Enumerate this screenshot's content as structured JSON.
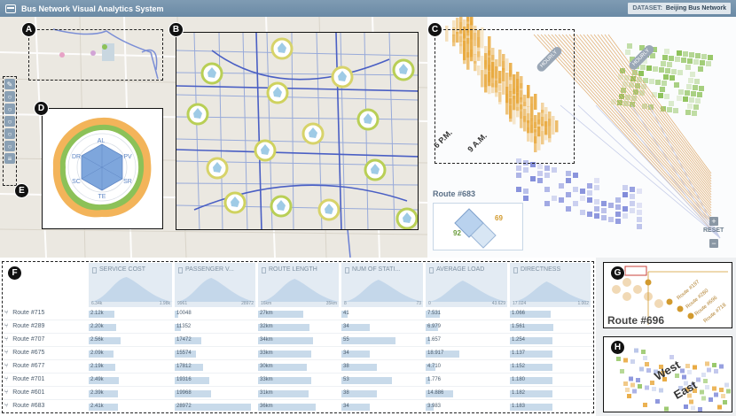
{
  "app": {
    "title": "Bus Network Visual Analytics System",
    "dataset_label": "DATASET:",
    "dataset_value": "Beijing Bus Network"
  },
  "badges": [
    "A",
    "B",
    "C",
    "D",
    "E",
    "F",
    "G",
    "H"
  ],
  "radar": {
    "axes": [
      "AL",
      "PV",
      "SR",
      "TE",
      "SC",
      "DR"
    ]
  },
  "matrix": {
    "label_6pm": "6 P.M.",
    "label_9am": "9 A.M.",
    "hourly_left": "HOURLY",
    "hourly_right": "HOURLY",
    "route_title": "Route #683",
    "compare_left": "92",
    "compare_right": "69",
    "reset": "RESET",
    "zoom_in": "+",
    "zoom_out": "−"
  },
  "table": {
    "columns": [
      {
        "name": "SERVICE COST",
        "lo": "6.34k",
        "hi": "1.98k"
      },
      {
        "name": "PASSENGER V...",
        "lo": "9961",
        "hi": "28972"
      },
      {
        "name": "ROUTE LENGTH",
        "lo": "16km",
        "hi": "35km"
      },
      {
        "name": "NUM OF STATI...",
        "lo": "8",
        "hi": "73"
      },
      {
        "name": "AVERAGE LOAD",
        "lo": "0",
        "hi": "43.629"
      },
      {
        "name": "DIRECTNESS",
        "lo": "17.024",
        "hi": "1.002"
      }
    ],
    "rows": [
      {
        "name": "Route #715",
        "v": [
          "2.12k",
          "10048",
          "27km",
          "41",
          "7.531",
          "1.066"
        ],
        "p": [
          0.32,
          0.05,
          0.58,
          0.08,
          0.18,
          0.52
        ]
      },
      {
        "name": "Route #289",
        "v": [
          "2.20k",
          "11352",
          "32km",
          "34",
          "6.979",
          "1.561"
        ],
        "p": [
          0.34,
          0.08,
          0.66,
          0.36,
          0.16,
          0.56
        ]
      },
      {
        "name": "Route #707",
        "v": [
          "2.56k",
          "17472",
          "34km",
          "55",
          "1.657",
          "1.254"
        ],
        "p": [
          0.39,
          0.34,
          0.7,
          0.68,
          0.05,
          0.54
        ]
      },
      {
        "name": "Route #675",
        "v": [
          "2.09k",
          "15574",
          "33km",
          "34",
          "18.917",
          "1.137"
        ],
        "p": [
          0.31,
          0.27,
          0.68,
          0.36,
          0.43,
          0.55
        ]
      },
      {
        "name": "Route #677",
        "v": [
          "2.19k",
          "17812",
          "30km",
          "38",
          "4.710",
          "1.152"
        ],
        "p": [
          0.33,
          0.36,
          0.63,
          0.45,
          0.12,
          0.55
        ]
      },
      {
        "name": "Route #701",
        "v": [
          "2.49k",
          "19316",
          "33km",
          "53",
          "1.776",
          "1.180"
        ],
        "p": [
          0.37,
          0.44,
          0.68,
          0.64,
          0.06,
          0.55
        ]
      },
      {
        "name": "Route #601",
        "v": [
          "2.39k",
          "19968",
          "31km",
          "38",
          "14.886",
          "1.182"
        ],
        "p": [
          0.36,
          0.47,
          0.65,
          0.45,
          0.35,
          0.55
        ]
      },
      {
        "name": "Route #683",
        "v": [
          "2.41k",
          "28972",
          "36km",
          "34",
          "3.983",
          "1.183"
        ],
        "p": [
          0.36,
          0.98,
          0.74,
          0.36,
          0.1,
          0.55
        ]
      }
    ]
  },
  "panelG": {
    "big_label": "Route #696",
    "routes": [
      "Route #197",
      "Route #280",
      "Route #696",
      "Route #718"
    ]
  },
  "panelH": {
    "west": "West",
    "east": "East"
  },
  "colors": {
    "accent": "#4a6cd4",
    "orange": "#e8a83c",
    "green": "#8cc158",
    "purple": "#7b86d8"
  }
}
